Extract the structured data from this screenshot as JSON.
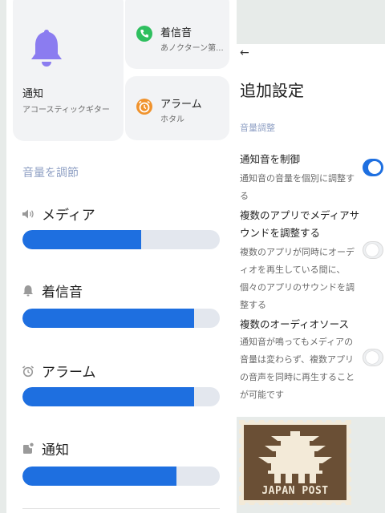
{
  "sound_cards": {
    "notification": {
      "title": "通知",
      "value": "アコースティックギター"
    },
    "ringtone": {
      "title": "着信音",
      "value": "あノクターン第..."
    },
    "alarm": {
      "title": "アラーム",
      "value": "ホタル"
    }
  },
  "volume": {
    "heading": "音量を調節",
    "rows": [
      {
        "label": "メディア",
        "icon": "speaker-icon",
        "level_percent": 60
      },
      {
        "label": "着信音",
        "icon": "bell-icon",
        "level_percent": 87
      },
      {
        "label": "アラーム",
        "icon": "alarm-clock-icon",
        "level_percent": 87
      },
      {
        "label": "通知",
        "icon": "notification-icon",
        "level_percent": 78
      }
    ]
  },
  "additional_settings": {
    "back_icon": "back-arrow-icon",
    "back_glyph": "←",
    "title": "追加設定",
    "section": "音量調整",
    "options": [
      {
        "title": "通知音を制御",
        "description": "通知音の音量を個別に調整する",
        "enabled": true
      },
      {
        "title": "複数のアプリでメディアサウンドを調整する",
        "description": "複数のアプリが同時にオーディオを再生している間に、個々のアプリのサウンドを調整する",
        "enabled": false
      },
      {
        "title": "複数のオーディオソース",
        "description": "通知音が鳴ってもメディアの音量は変わらず、複数アプリの音声を同時に再生することが可能です",
        "enabled": false
      }
    ]
  },
  "stamp": {
    "text": "JAPAN POST"
  },
  "colors": {
    "accent": "#1e6fe0",
    "track": "#e3e7ee",
    "section_heading": "#8fa0c4",
    "card_bg": "#f2f3f5",
    "bell": "#8b7cf0"
  }
}
